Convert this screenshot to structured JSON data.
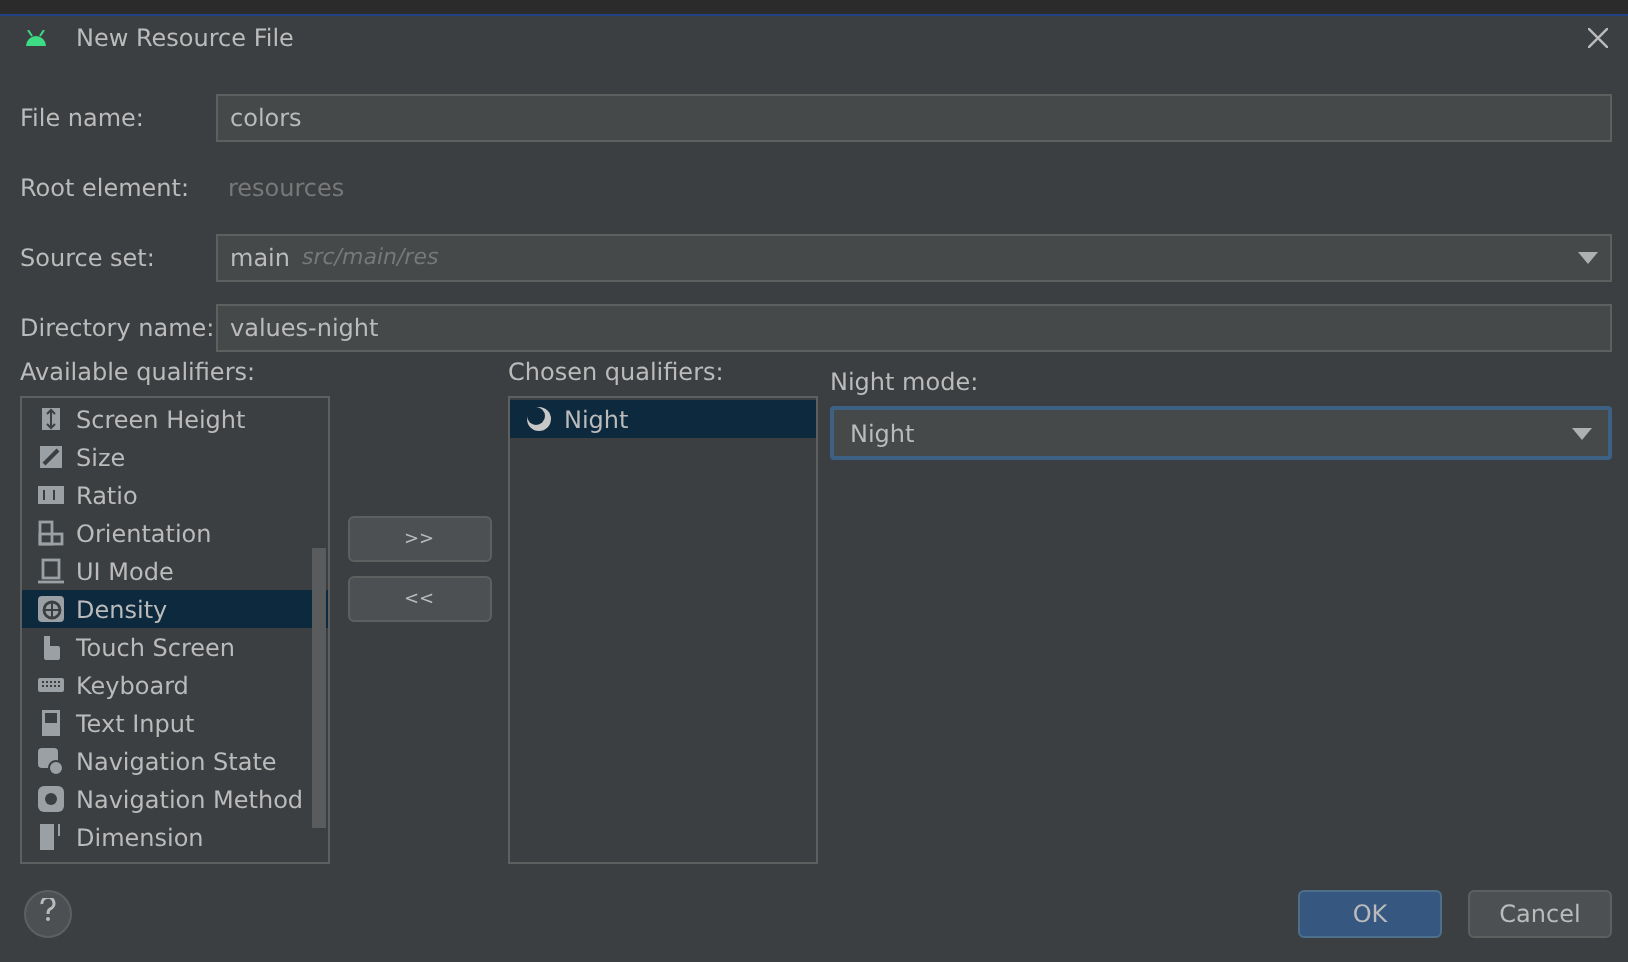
{
  "window": {
    "title": "New Resource File"
  },
  "form": [
    {
      "label": "File name:",
      "kind": "input",
      "value": "colors"
    },
    {
      "label": "Root element:",
      "kind": "static",
      "value": "resources"
    },
    {
      "label": "Source set:",
      "kind": "select",
      "value": "main",
      "hint": "src/main/res"
    },
    {
      "label": "Directory name:",
      "kind": "input",
      "value": "values-night"
    }
  ],
  "available_qualifiers": {
    "label": "Available qualifiers:",
    "items": [
      {
        "label": "Screen Height",
        "selected": false
      },
      {
        "label": "Size",
        "selected": false
      },
      {
        "label": "Ratio",
        "selected": false
      },
      {
        "label": "Orientation",
        "selected": false
      },
      {
        "label": "UI Mode",
        "selected": false
      },
      {
        "label": "Density",
        "selected": true
      },
      {
        "label": "Touch Screen",
        "selected": false
      },
      {
        "label": "Keyboard",
        "selected": false
      },
      {
        "label": "Text Input",
        "selected": false
      },
      {
        "label": "Navigation State",
        "selected": false
      },
      {
        "label": "Navigation Method",
        "selected": false
      },
      {
        "label": "Dimension",
        "selected": false
      }
    ]
  },
  "move_buttons": [
    ">>",
    "<<"
  ],
  "chosen_qualifiers": {
    "label": "Chosen qualifiers:",
    "items": [
      {
        "label": "Night",
        "selected": true
      }
    ]
  },
  "night_mode": {
    "label": "Night mode:",
    "value": "Night"
  },
  "buttons": [
    {
      "label": "OK",
      "kind": "primary"
    },
    {
      "label": "Cancel",
      "kind": "secondary"
    }
  ]
}
